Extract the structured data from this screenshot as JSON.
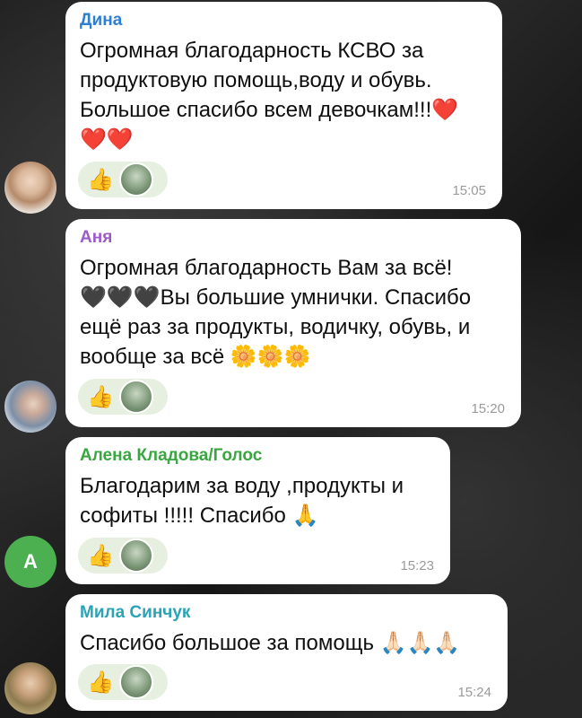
{
  "messages": [
    {
      "sender": "Дина",
      "sender_color": "#2f7fd1",
      "lines": [
        "Огромная благодарность КСВО за",
        "продуктовую помощь,воду и обувь.",
        "Большое спасибо всем девочкам!!!❤️",
        "❤️❤️"
      ],
      "reaction": "👍",
      "time": "15:05"
    },
    {
      "sender": "Аня",
      "sender_color": "#9b59c9",
      "lines": [
        "Огромная благодарность Вам за всё!",
        "🖤🖤🖤Вы большие умнички. Спасибо",
        "ещё раз за продукты, водичку, обувь, и",
        "вообще за всё 🌼🌼🌼"
      ],
      "reaction": "👍",
      "time": "15:20"
    },
    {
      "sender": "Алена Кладова/Голос",
      "sender_color": "#3aa640",
      "lines": [
        "Благодарим за воду ,продукты и",
        "софиты !!!!! Спасибо 🙏"
      ],
      "reaction": "👍",
      "time": "15:23",
      "avatar_letter": "А",
      "avatar_color": "#4caf50"
    },
    {
      "sender": "Мила Синчук",
      "sender_color": "#2aa3b5",
      "lines": [
        "Спасибо большое за помощь 🙏🏻🙏🏻🙏🏻"
      ],
      "reaction": "👍",
      "time": "15:24"
    }
  ]
}
